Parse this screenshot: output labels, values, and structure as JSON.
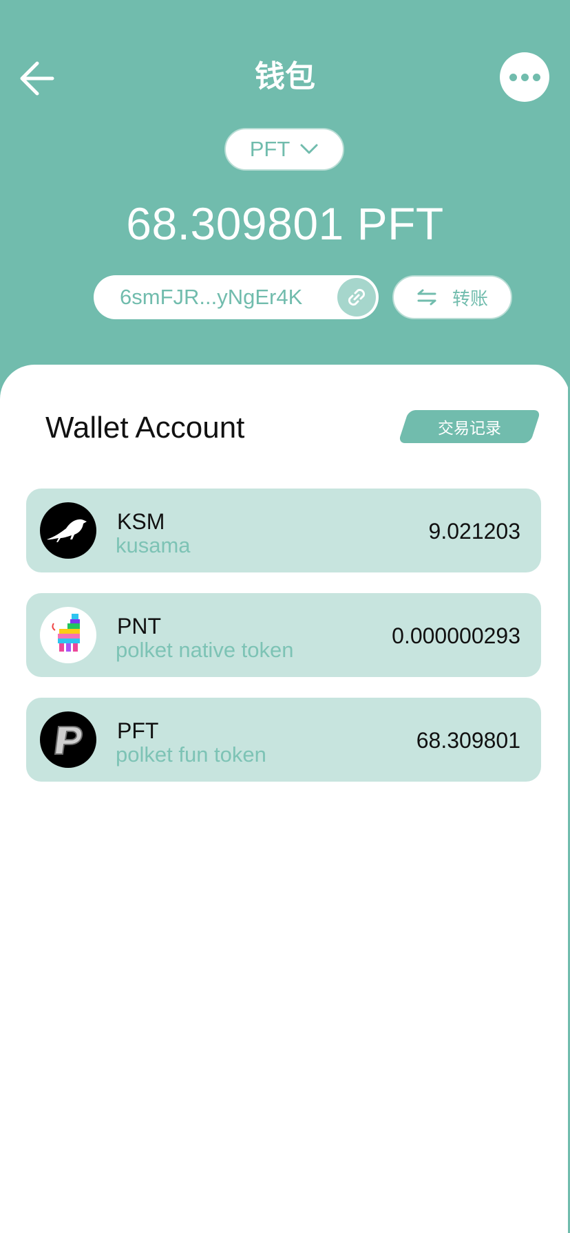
{
  "header": {
    "title": "钱包",
    "token_selector": "PFT",
    "balance": "68.309801 PFT",
    "address": "6smFJR...yNgEr4K",
    "transfer_label": "转账"
  },
  "wallet": {
    "section_title": "Wallet Account",
    "history_label": "交易记录",
    "tokens": [
      {
        "symbol": "KSM",
        "name": "kusama",
        "amount": "9.021203",
        "icon": "kusama-bird-icon"
      },
      {
        "symbol": "PNT",
        "name": "polket native token",
        "amount": "0.000000293",
        "icon": "llama-pinata-icon"
      },
      {
        "symbol": "PFT",
        "name": "polket fun token",
        "amount": "68.309801",
        "icon": "pft-p-icon"
      }
    ]
  },
  "colors": {
    "primary": "#71bcad",
    "row_background": "#c7e4de",
    "secondary_text": "#7dc3b5"
  }
}
